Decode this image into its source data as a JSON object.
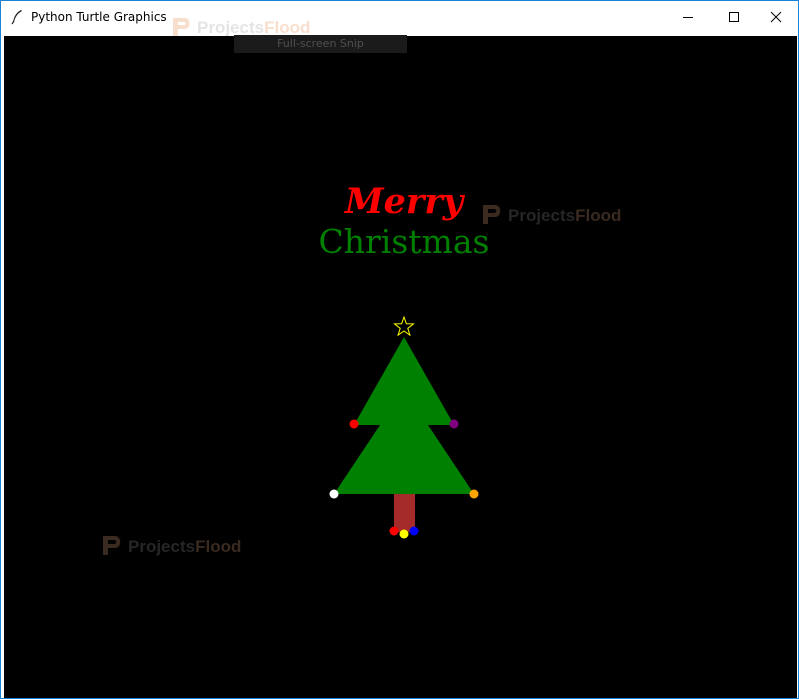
{
  "window": {
    "title": "Python Turtle Graphics",
    "controls": {
      "minimize": "minimize",
      "maximize": "maximize",
      "close": "close"
    }
  },
  "tooltip": {
    "text": "Full-screen Snip"
  },
  "canvas": {
    "background": "#000000",
    "greeting": {
      "line1": "Merry",
      "line1_color": "#ff0000",
      "line2": "Christmas",
      "line2_color": "#008000"
    },
    "tree": {
      "foliage_color": "#008000",
      "trunk_color": "#a52a2a",
      "star_color": "#ffff00",
      "ornament_colors": [
        "#ff0000",
        "#800080",
        "#ffffff",
        "#ffa500",
        "#ff0000",
        "#0000ff",
        "#ffff00"
      ]
    }
  },
  "watermark": {
    "word1": "Projects",
    "word2": "Flood",
    "color1": "#2a2a2a",
    "color2": "#3a2a20"
  }
}
